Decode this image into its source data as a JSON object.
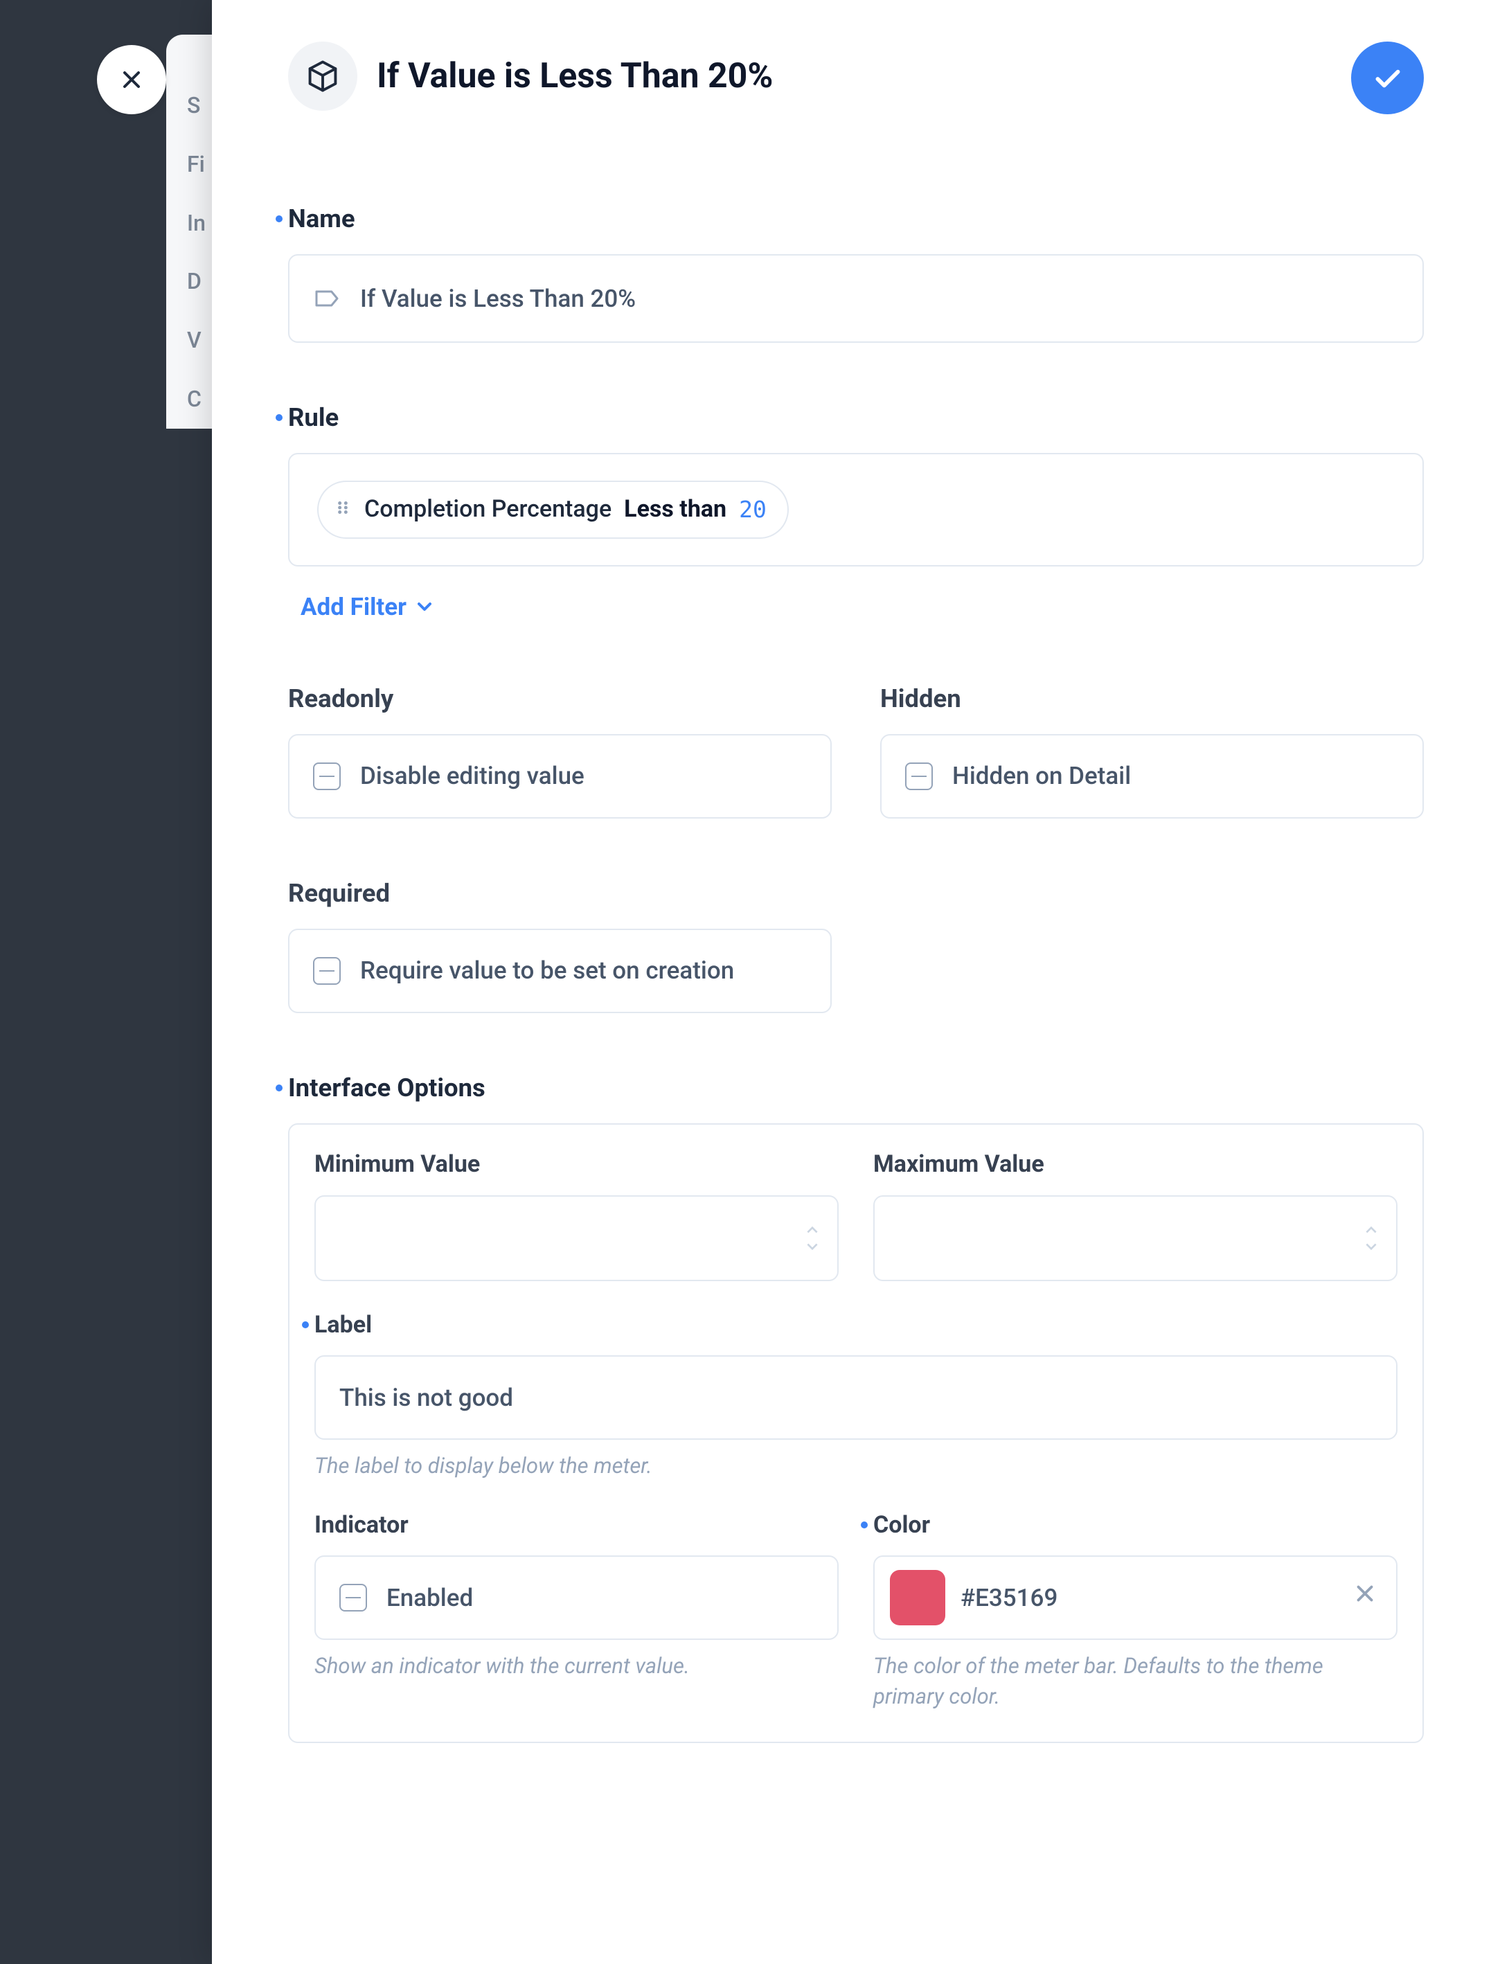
{
  "bg_nav": [
    "S",
    "Fi",
    "In",
    "D",
    "V",
    "C"
  ],
  "title": "If Value is Less Than 20%",
  "sections": {
    "name": {
      "label": "Name",
      "value": "If Value is Less Than 20%"
    },
    "rule": {
      "label": "Rule",
      "chip_field": "Completion Percentage",
      "chip_op": "Less than",
      "chip_val": "20",
      "add_filter": "Add Filter"
    },
    "readonly": {
      "label": "Readonly",
      "text": "Disable editing value"
    },
    "hidden": {
      "label": "Hidden",
      "text": "Hidden on Detail"
    },
    "required": {
      "label": "Required",
      "text": "Require value to be set on creation"
    },
    "interface": {
      "label": "Interface Options",
      "min": {
        "label": "Minimum Value",
        "value": ""
      },
      "max": {
        "label": "Maximum Value",
        "value": ""
      },
      "labelField": {
        "label": "Label",
        "value": "This is not good",
        "hint": "The label to display below the meter."
      },
      "indicator": {
        "label": "Indicator",
        "value": "Enabled",
        "hint": "Show an indicator with the current value."
      },
      "color": {
        "label": "Color",
        "value": "#E35169",
        "swatch": "#E35169",
        "hint": "The color of the meter bar. Defaults to the theme primary color."
      }
    }
  }
}
